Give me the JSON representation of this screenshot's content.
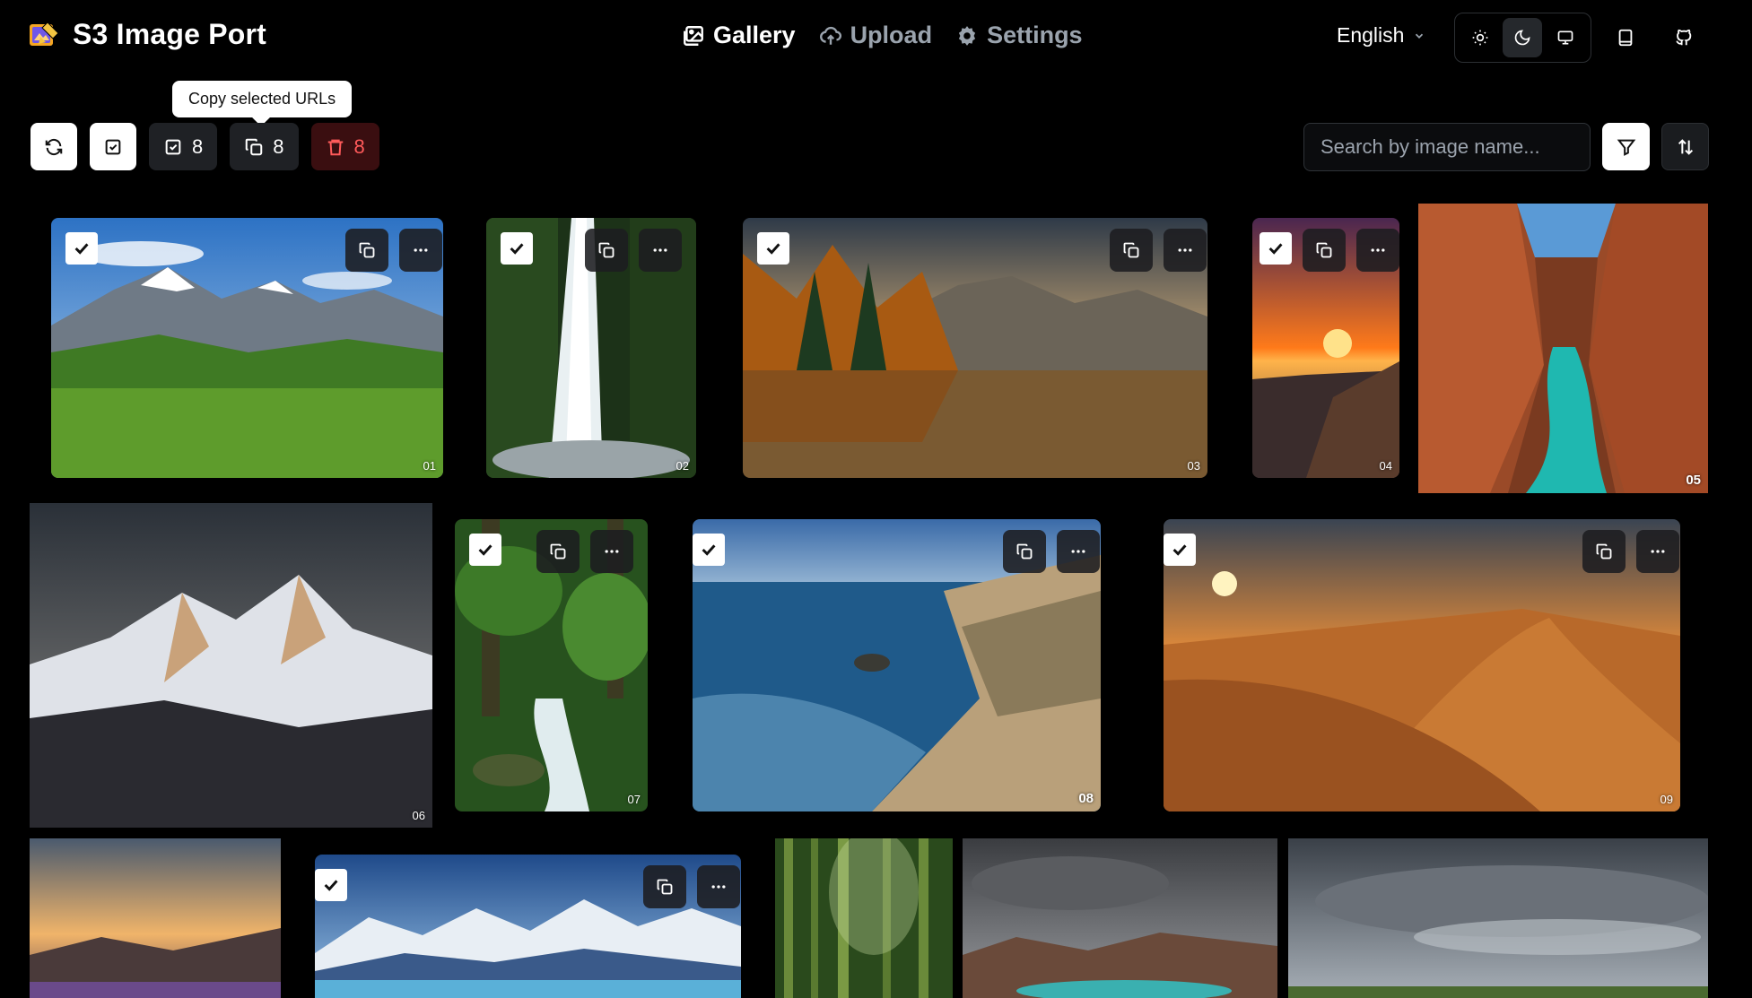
{
  "app": {
    "title": "S3 Image Port"
  },
  "nav": [
    {
      "label": "Gallery",
      "active": true,
      "icon": "gallery-icon"
    },
    {
      "label": "Upload",
      "active": false,
      "icon": "upload-cloud-icon"
    },
    {
      "label": "Settings",
      "active": false,
      "icon": "gear-icon"
    }
  ],
  "language": {
    "selected": "English"
  },
  "theme": {
    "options": [
      "light",
      "dark",
      "system"
    ],
    "selected": "dark"
  },
  "tooltip": {
    "text": "Copy selected URLs"
  },
  "toolbar": {
    "selected_count": "8",
    "copy_count": "8",
    "delete_count": "8"
  },
  "search": {
    "placeholder": "Search by image name..."
  },
  "colors": {
    "background": "#000000",
    "danger": "#ff5a5a",
    "danger_bg": "#3a0e10"
  },
  "images": [
    {
      "label": "01",
      "selected": true
    },
    {
      "label": "02",
      "selected": true
    },
    {
      "label": "03",
      "selected": true
    },
    {
      "label": "04",
      "selected": true
    },
    {
      "label": "05",
      "selected": false
    },
    {
      "label": "06",
      "selected": false
    },
    {
      "label": "07",
      "selected": true
    },
    {
      "label": "08",
      "selected": true
    },
    {
      "label": "09",
      "selected": true
    },
    {
      "label": "",
      "selected": false
    },
    {
      "label": "",
      "selected": true
    },
    {
      "label": "",
      "selected": false
    },
    {
      "label": "",
      "selected": false
    },
    {
      "label": "",
      "selected": false
    }
  ]
}
